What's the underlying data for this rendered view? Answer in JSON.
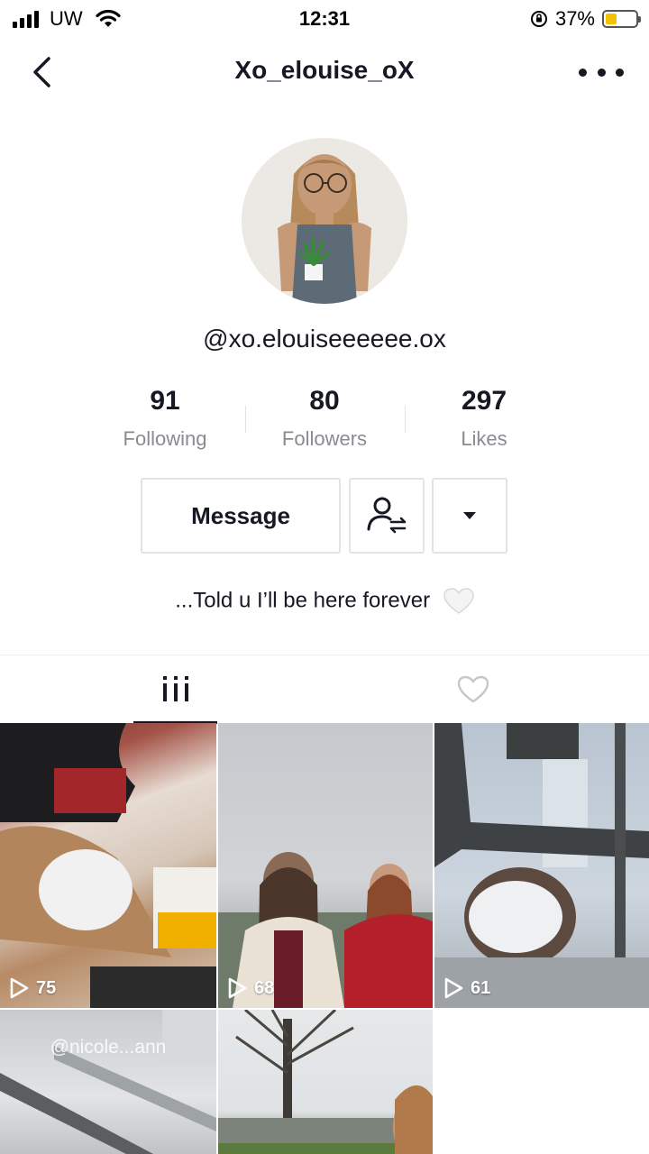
{
  "status_bar": {
    "carrier": "UW",
    "time": "12:31",
    "battery_percent": "37%",
    "battery_level": 0.37
  },
  "header": {
    "title": "Xo_elouise_oX"
  },
  "profile": {
    "username": "@xo.elouiseeeeee.ox",
    "bio": "...Told u I’ll be here forever"
  },
  "stats": [
    {
      "value": "91",
      "label": "Following"
    },
    {
      "value": "80",
      "label": "Followers"
    },
    {
      "value": "297",
      "label": "Likes"
    }
  ],
  "actions": {
    "message_label": "Message"
  },
  "videos": [
    {
      "views": "75"
    },
    {
      "views": "68"
    },
    {
      "views": "61"
    },
    {
      "views": "",
      "overlay_text": "@nicole...ann"
    },
    {
      "views": ""
    }
  ],
  "colors": {
    "text_primary": "#161823",
    "text_secondary": "#8a8b91",
    "border": "#e3e3e4"
  }
}
